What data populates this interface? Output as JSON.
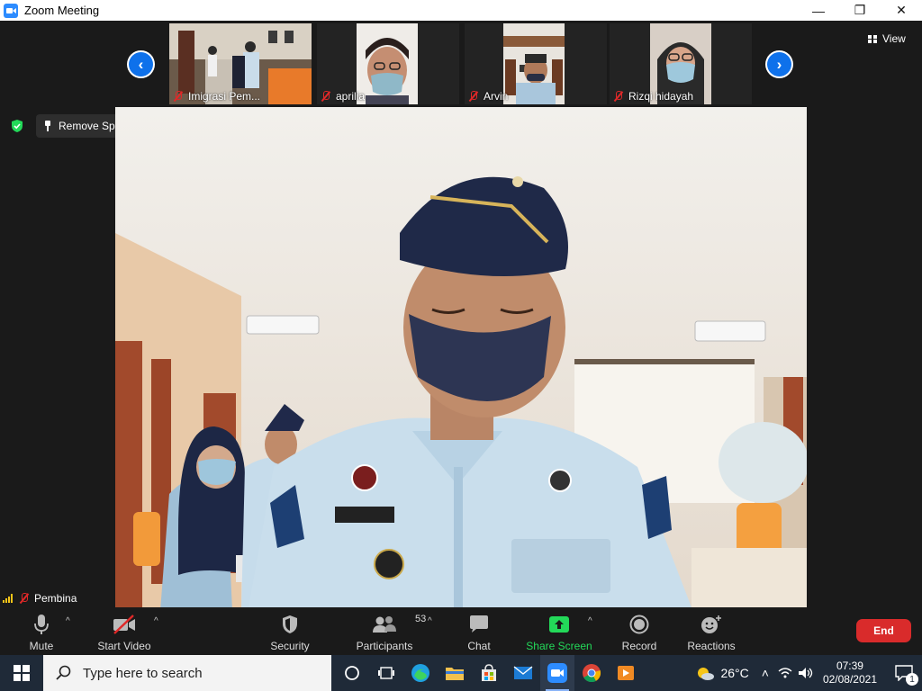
{
  "window": {
    "title": "Zoom Meeting",
    "minimize_glyph": "—",
    "restore_glyph": "❐",
    "close_glyph": "✕"
  },
  "thumbnails": [
    {
      "name": "Imigrasi Pem...",
      "muted": true
    },
    {
      "name": "aprilia",
      "muted": true
    },
    {
      "name": "Arvin",
      "muted": true
    },
    {
      "name": "Rizqi hidayah",
      "muted": true
    }
  ],
  "view_button": "View",
  "spotlight": {
    "remove_label": "Remove Spotlight",
    "speaker_name": "Pembina"
  },
  "toolbar": {
    "mute": "Mute",
    "start_video": "Start Video",
    "security": "Security",
    "participants": "Participants",
    "participant_count": "53",
    "chat": "Chat",
    "share_screen": "Share Screen",
    "record": "Record",
    "reactions": "Reactions",
    "end": "End"
  },
  "taskbar": {
    "search_placeholder": "Type here to search",
    "weather": "26°C",
    "time": "07:39",
    "date": "02/08/2021",
    "notification_count": "1"
  },
  "colors": {
    "zoom_blue": "#0e71eb",
    "share_green": "#23d959",
    "end_red": "#d92b2b",
    "muted_red": "#e02828",
    "taskbar": "#1f2a38"
  }
}
